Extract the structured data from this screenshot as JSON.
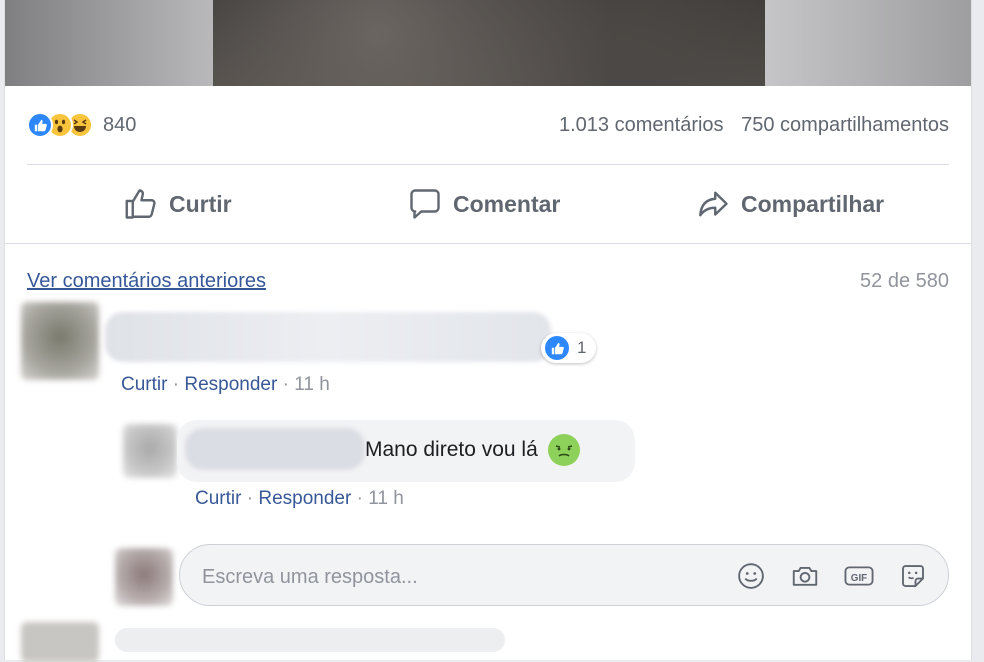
{
  "post": {
    "reactions": [
      "like-icon",
      "wow-icon",
      "haha-icon"
    ],
    "reaction_count": "840",
    "comments_count": "1.013 comentários",
    "shares_count": "750 compartilhamentos"
  },
  "actions": {
    "like": "Curtir",
    "comment": "Comentar",
    "share": "Compartilhar"
  },
  "comments_section": {
    "prev_link": "Ver comentários anteriores",
    "pager": "52 de 580"
  },
  "comment1": {
    "like_count": "1",
    "like": "Curtir",
    "reply": "Responder",
    "time": "11 h"
  },
  "reply1": {
    "text": "Mano direto vou lá",
    "emoji": "nauseated-face-icon",
    "like": "Curtir",
    "reply": "Responder",
    "time": "11 h"
  },
  "reply_input": {
    "placeholder": "Escreva uma resposta...",
    "icons": [
      "emoji-icon",
      "camera-icon",
      "gif-icon",
      "sticker-icon"
    ]
  },
  "colors": {
    "link": "#365899",
    "secondary_text": "#606770",
    "muted_text": "#90949c",
    "like_blue": "#2d88ff",
    "bubble": "#f2f3f5"
  }
}
